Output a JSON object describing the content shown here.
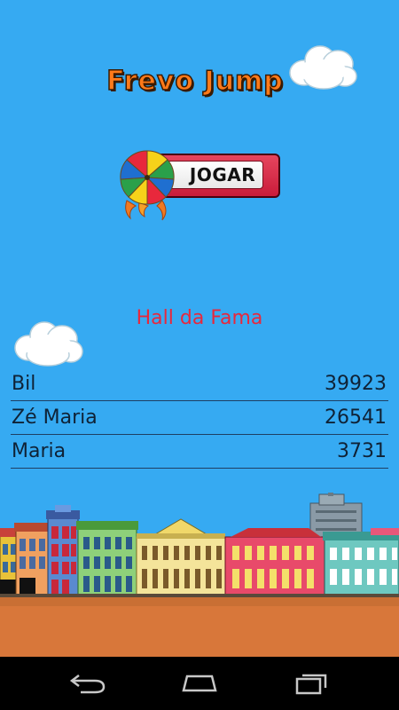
{
  "game": {
    "title": "Frevo Jump",
    "play_button_label": "JOGAR",
    "hall_of_fame_title": "Hall da Fama"
  },
  "high_scores": [
    {
      "name": "Bil",
      "score": "39923"
    },
    {
      "name": "Zé Maria",
      "score": "26541"
    },
    {
      "name": "Maria",
      "score": "3731"
    }
  ],
  "colors": {
    "sky": "#36aaf2",
    "title": "#ff7a1a",
    "hall_title": "#e8283c",
    "button": "#d8263f",
    "ground": "#d8773a"
  },
  "icons": {
    "play_umbrella": "frevo-umbrella-icon",
    "nav_back": "back-icon",
    "nav_home": "home-icon",
    "nav_recent": "recent-apps-icon"
  }
}
